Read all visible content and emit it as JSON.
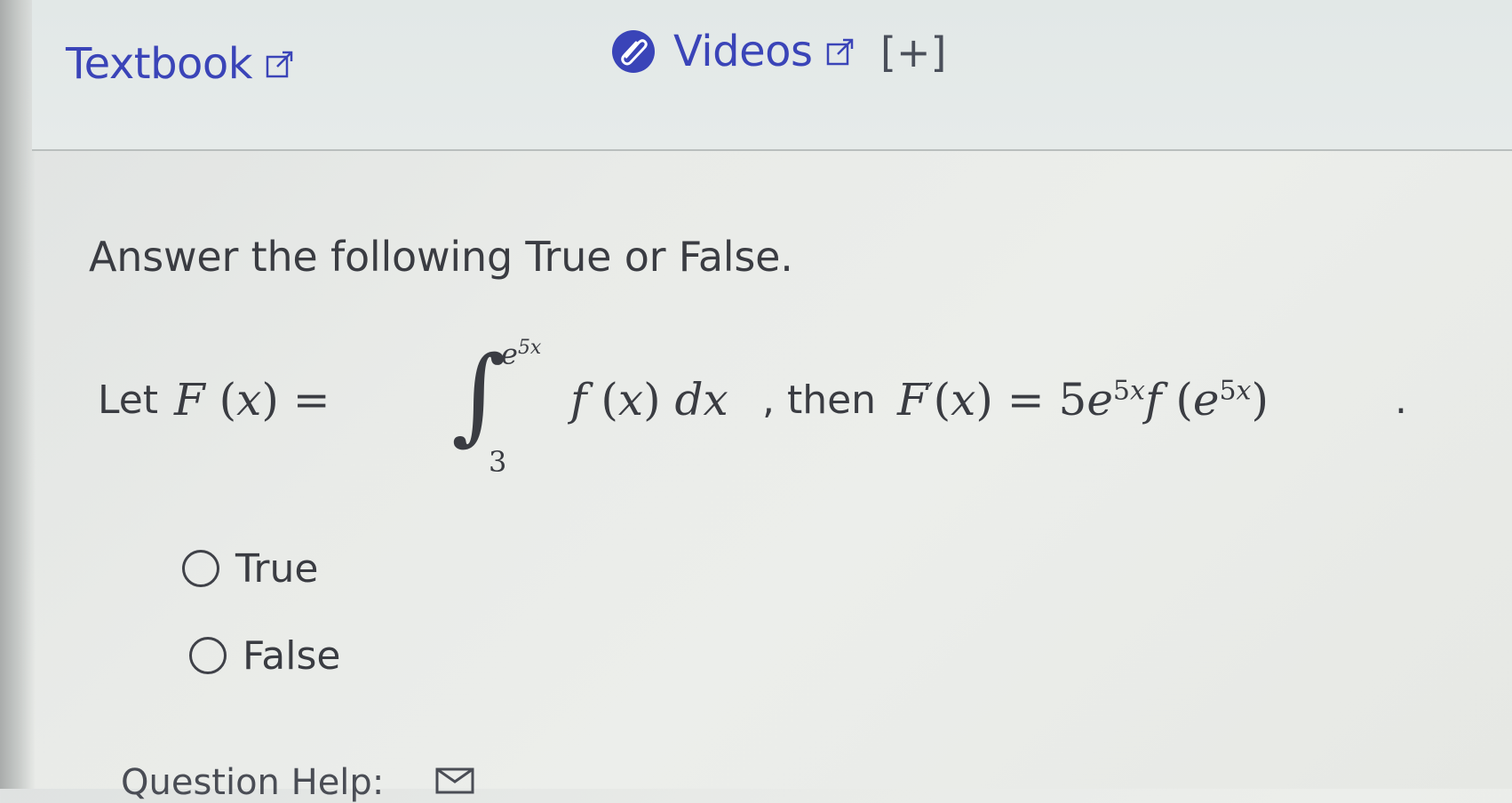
{
  "resources": {
    "textbook_label": "Textbook",
    "videos_label": "Videos",
    "expand_label": "[+]",
    "icons": {
      "external": "external-link-icon",
      "clip": "paperclip-icon"
    }
  },
  "question": {
    "prompt": "Answer the following True or False.",
    "statement_prefix": "Let",
    "math_lhs": "F(x) =",
    "integral_upper": "e^{5x}",
    "integral_lower": "3",
    "integrand": "f(x) dx",
    "statement_mid": ", then",
    "math_rhs": "F′(x) = 5e^{5x} f(e^{5x})",
    "statement_end": "."
  },
  "options": [
    {
      "label": "True",
      "selected": false
    },
    {
      "label": "False",
      "selected": false
    }
  ],
  "footer": {
    "help_label": "Question Help:"
  },
  "colors": {
    "link": "#3a44b8",
    "text": "#3a3c42"
  }
}
